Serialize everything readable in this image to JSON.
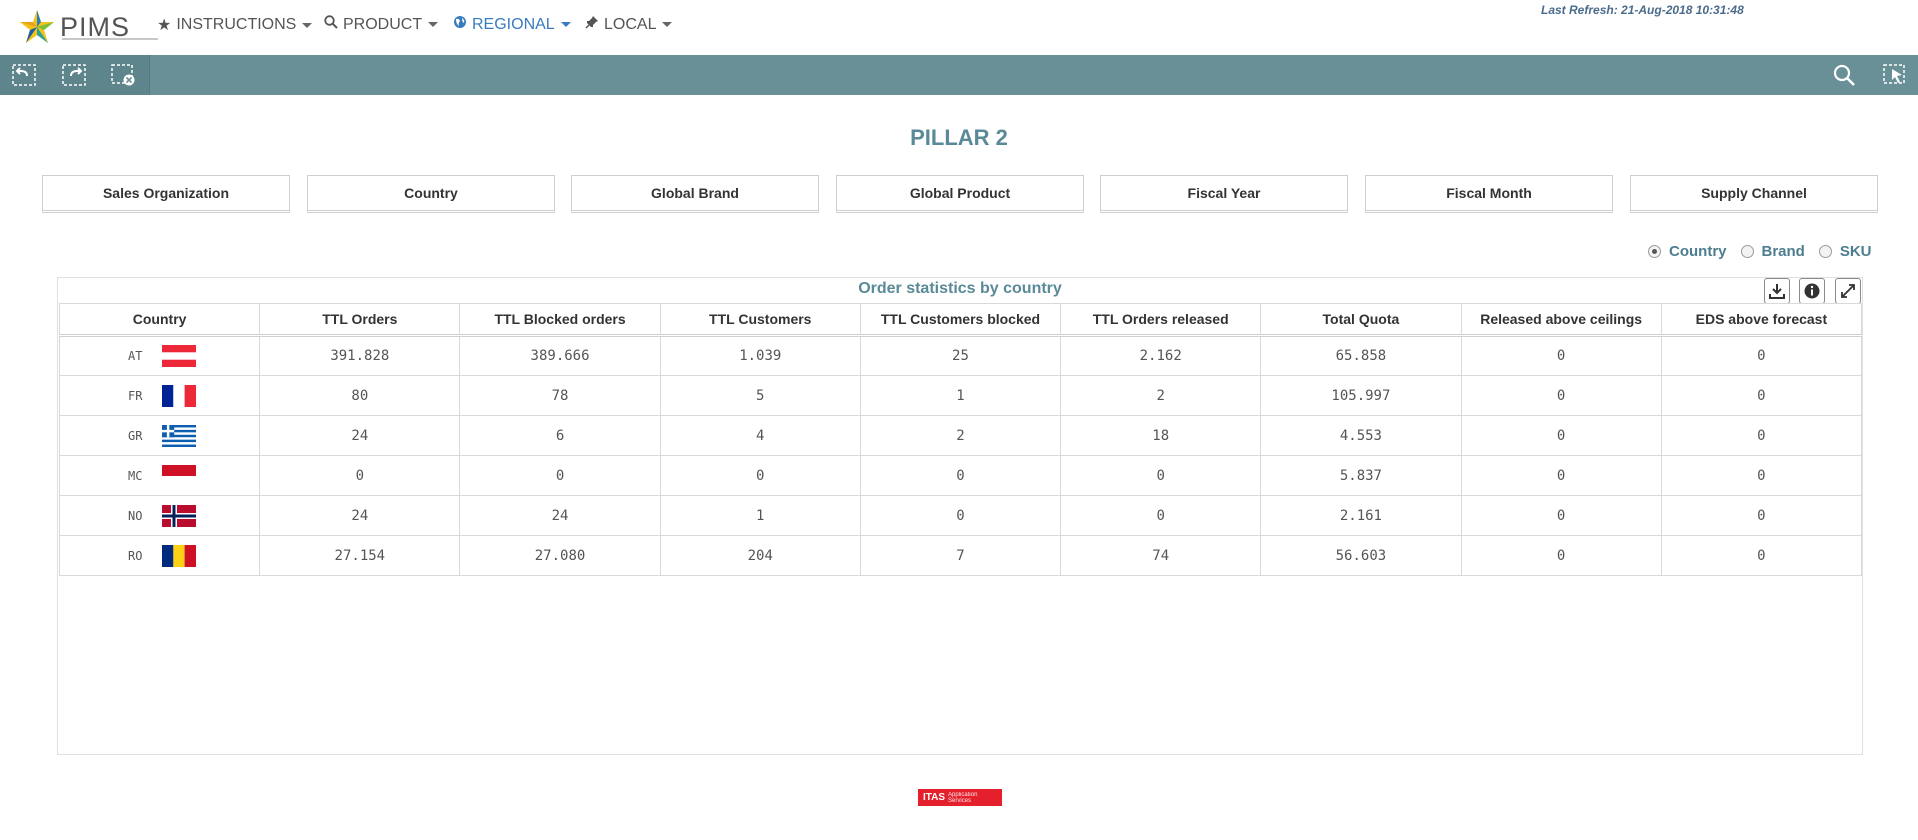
{
  "app": {
    "logo_text": "PIMS",
    "last_refresh": "Last Refresh: 21-Aug-2018 10:31:48"
  },
  "nav": {
    "items": [
      {
        "label": "INSTRUCTIONS",
        "icon": "star-icon"
      },
      {
        "label": "PRODUCT",
        "icon": "search-icon"
      },
      {
        "label": "REGIONAL",
        "icon": "globe-icon",
        "active": true
      },
      {
        "label": "LOCAL",
        "icon": "pin-icon"
      }
    ]
  },
  "toolbar": {
    "buttons": [
      "back-selection-icon",
      "forward-selection-icon",
      "clear-selections-icon",
      "search-icon",
      "selections-tool-icon"
    ]
  },
  "page": {
    "title": "PILLAR 2"
  },
  "filters": [
    "Sales Organization",
    "Country",
    "Global Brand",
    "Global Product",
    "Fiscal Year",
    "Fiscal Month",
    "Supply Channel"
  ],
  "view_options": {
    "options": [
      "Country",
      "Brand",
      "SKU"
    ],
    "selected": "Country"
  },
  "panel": {
    "title": "Order statistics by country",
    "buttons": [
      "download-icon",
      "info-icon",
      "expand-icon"
    ],
    "columns": [
      "Country",
      "TTL Orders",
      "TTL Blocked orders",
      "TTL Customers",
      "TTL Customers blocked",
      "TTL Orders released",
      "Total Quota",
      "Released above ceilings",
      "EDS above forecast"
    ],
    "rows": [
      {
        "code": "AT",
        "values": [
          "391.828",
          "389.666",
          "1.039",
          "25",
          "2.162",
          "65.858",
          "0",
          "0"
        ]
      },
      {
        "code": "FR",
        "values": [
          "80",
          "78",
          "5",
          "1",
          "2",
          "105.997",
          "0",
          "0"
        ]
      },
      {
        "code": "GR",
        "values": [
          "24",
          "6",
          "4",
          "2",
          "18",
          "4.553",
          "0",
          "0"
        ]
      },
      {
        "code": "MC",
        "values": [
          "0",
          "0",
          "0",
          "0",
          "0",
          "5.837",
          "0",
          "0"
        ]
      },
      {
        "code": "NO",
        "values": [
          "24",
          "24",
          "1",
          "0",
          "0",
          "2.161",
          "0",
          "0"
        ]
      },
      {
        "code": "RO",
        "values": [
          "27.154",
          "27.080",
          "204",
          "7",
          "74",
          "56.603",
          "0",
          "0"
        ]
      }
    ]
  },
  "footer": {
    "logo_text": "ITAS",
    "logo_sub": "Application Services"
  },
  "colors": {
    "toolbar": "#6a9097",
    "title": "#5a8a98",
    "active_nav": "#3a7bbf",
    "footer_logo": "#e3202b"
  }
}
